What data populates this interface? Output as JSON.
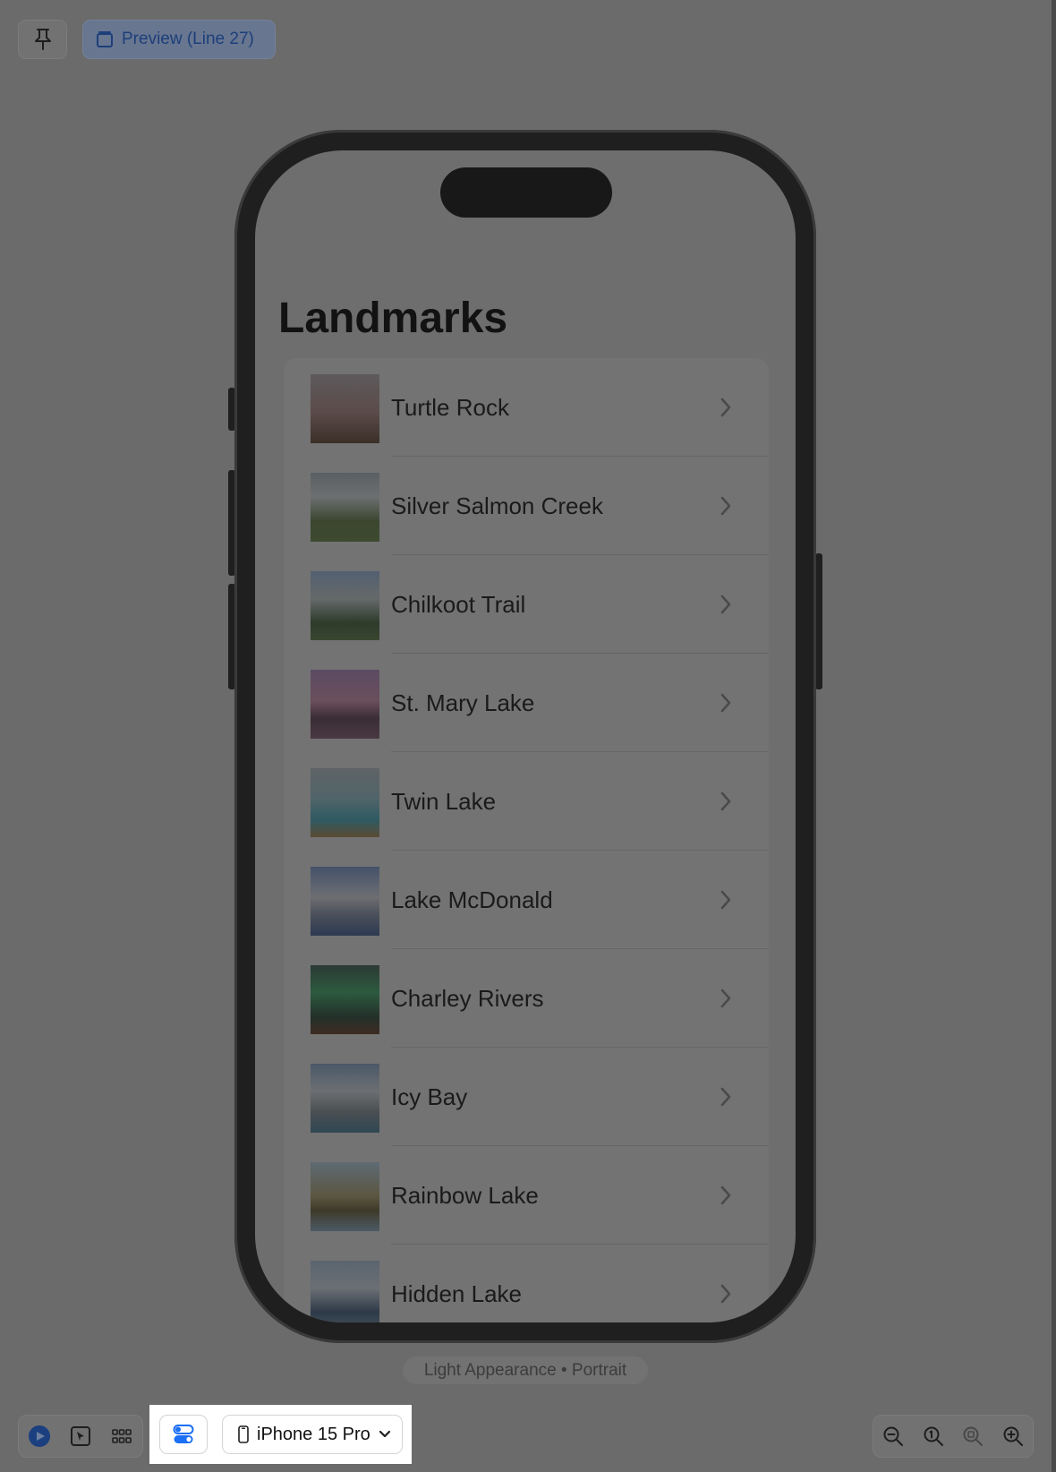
{
  "top_toolbar": {
    "pin_icon": "pin-icon",
    "preview_icon": "window-icon",
    "preview_label": "Preview (Line 27)"
  },
  "screen": {
    "title": "Landmarks",
    "items": [
      {
        "name": "Turtle Rock"
      },
      {
        "name": "Silver Salmon Creek"
      },
      {
        "name": "Chilkoot Trail"
      },
      {
        "name": "St. Mary Lake"
      },
      {
        "name": "Twin Lake"
      },
      {
        "name": "Lake McDonald"
      },
      {
        "name": "Charley Rivers"
      },
      {
        "name": "Icy Bay"
      },
      {
        "name": "Rainbow Lake"
      },
      {
        "name": "Hidden Lake"
      }
    ]
  },
  "caption": "Light Appearance • Portrait",
  "bottom_toolbar": {
    "live_icon": "play-icon",
    "select_icon": "cursor-select-icon",
    "grid_icon": "grid-icon",
    "variants_icon": "toggles-icon",
    "device_icon": "iphone-icon",
    "device_label": "iPhone 15 Pro",
    "device_chevron": "chevron-down-icon",
    "zoom_out_icon": "zoom-out-icon",
    "zoom_actual_icon": "zoom-actual-icon",
    "zoom_fit_icon": "zoom-fit-icon",
    "zoom_in_icon": "zoom-in-icon"
  },
  "colors": {
    "accent": "#1a6ff5",
    "dim_overlay": "#6b6b6b"
  }
}
